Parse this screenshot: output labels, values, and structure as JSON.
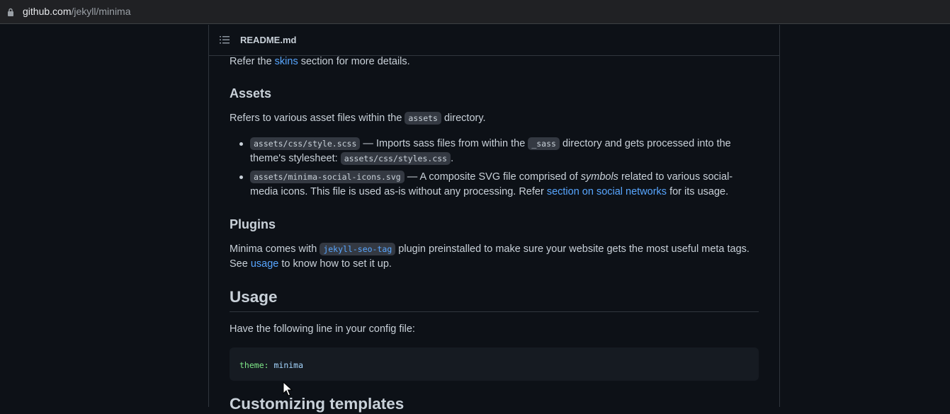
{
  "browser": {
    "url_host": "github.com",
    "url_path": "/jekyll/minima"
  },
  "readme": {
    "filename": "README.md"
  },
  "content": {
    "skins_line": {
      "prefix": "Refer the ",
      "link": "skins",
      "suffix": " section for more details."
    },
    "assets": {
      "heading": "Assets",
      "intro_prefix": "Refers to various asset files within the ",
      "intro_code": "assets",
      "intro_suffix": " directory.",
      "items": [
        {
          "code": "assets/css/style.scss",
          "text1": " — Imports sass files from within the ",
          "code2": "_sass",
          "text2": " directory and gets processed into the theme's stylesheet: ",
          "code3": "assets/css/styles.css",
          "text3": "."
        },
        {
          "code": "assets/minima-social-icons.svg",
          "text1": " — A composite SVG file comprised of ",
          "em": "symbols",
          "text2": " related to various social-media icons. This file is used as-is without any processing. Refer ",
          "link": "section on social networks",
          "text3": " for its usage."
        }
      ]
    },
    "plugins": {
      "heading": "Plugins",
      "prefix": "Minima comes with ",
      "code": "jekyll-seo-tag",
      "middle": " plugin preinstalled to make sure your website gets the most useful meta tags. See ",
      "link": "usage",
      "suffix": " to know how to set it up."
    },
    "usage": {
      "heading": "Usage",
      "text": "Have the following line in your config file:",
      "code_key": "theme:",
      "code_value": " minima"
    },
    "next_heading_partial": "Customizing templates"
  },
  "colors": {
    "page_bg": "#0d1117",
    "text": "#c9d1d9",
    "link": "#58a6ff",
    "border": "#30363d"
  },
  "icons": [
    "lock-icon",
    "list-icon",
    "mouse-cursor-icon"
  ]
}
